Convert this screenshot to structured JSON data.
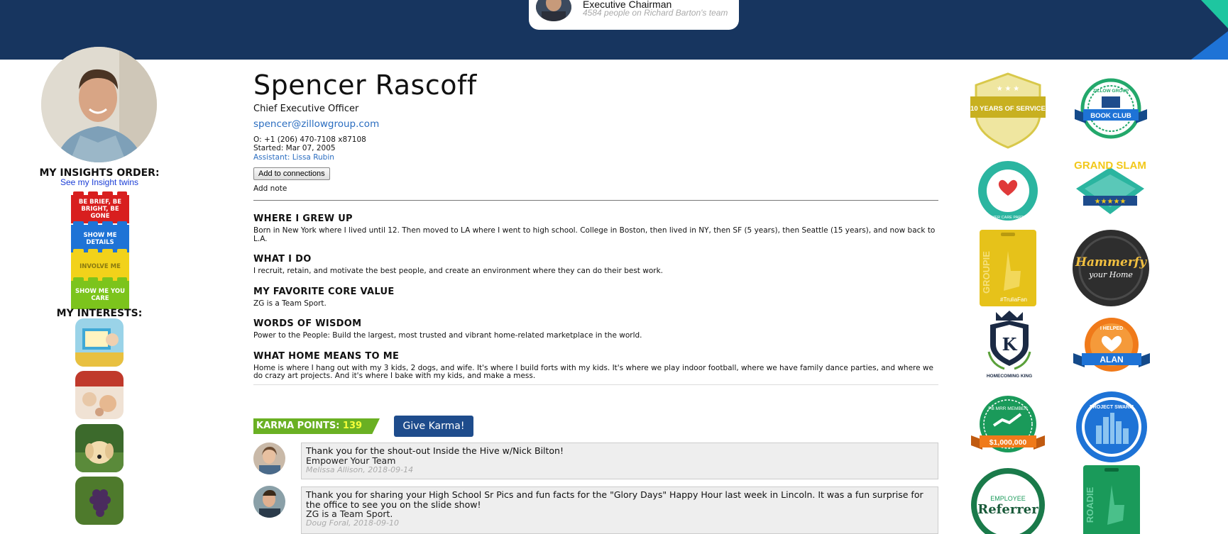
{
  "header": {
    "manager_title": "Executive Chairman",
    "manager_team": "4584 people on Richard Barton's team"
  },
  "left": {
    "insights_heading": "MY INSIGHTS ORDER:",
    "twins_link": "See my Insight twins",
    "insights": [
      {
        "label": "BE BRIEF, BE BRIGHT, BE GONE",
        "color": "#d81f1f"
      },
      {
        "label": "SHOW ME DETAILS",
        "color": "#1e73d6"
      },
      {
        "label": "INVOLVE ME",
        "color": "#f2d21a"
      },
      {
        "label": "SHOW ME YOU CARE",
        "color": "#7cc41c"
      }
    ],
    "interests_heading": "MY INTERESTS:"
  },
  "profile": {
    "name": "Spencer Rascoff",
    "title": "Chief Executive Officer",
    "email": "spencer@zillowgroup.com",
    "phone": "O: +1 (206) 470-7108 x87108",
    "started": "Started: Mar 07, 2005",
    "assistant": "Assistant: Lissa Rubin",
    "add_connections": "Add to connections",
    "add_note": "Add note"
  },
  "sections": [
    {
      "heading": "WHERE I GREW UP",
      "text": "Born in New York where I lived until 12. Then moved to LA where I went to high school. College in Boston, then lived in NY, then SF (5 years), then Seattle (15 years), and now back to L.A."
    },
    {
      "heading": "WHAT I DO",
      "text": "I recruit, retain, and motivate the best people, and create an environment where they can do their best work."
    },
    {
      "heading": "MY FAVORITE CORE VALUE",
      "text": "ZG is a Team Sport."
    },
    {
      "heading": "WORDS OF WISDOM",
      "text": "Power to the People: Build the largest, most trusted and vibrant home-related marketplace in the world."
    },
    {
      "heading": "WHAT HOME MEANS TO ME",
      "text": "Home is where I hang out with my 3 kids, 2 dogs, and wife. It's where I build forts with my kids. It's where we play indoor football, where we have family dance parties, and where we do crazy art projects. And it's where I bake with my kids, and make a mess."
    }
  ],
  "karma": {
    "label": "KARMA POINTS: ",
    "points": "139",
    "give_button": "Give Karma!"
  },
  "feedback": [
    {
      "text": "Thank you for the shout-out Inside the Hive w/Nick Bilton!",
      "value": "Empower Your Team",
      "meta": "Melissa Allison, 2018-09-14"
    },
    {
      "text": "Thank you for sharing your High School Sr Pics and fun facts for the \"Glory Days\" Happy Hour last week in Lincoln. It was a fun surprise for the office to see you on the slide show!",
      "value": "ZG is a Team Sport.",
      "meta": "Doug Foral, 2018-09-10"
    }
  ],
  "badges": {
    "b1": "10 YEARS OF SERVICE",
    "b2_top": "ZILLOW GROUP",
    "b2": "BOOK CLUB",
    "b3": "CONSUMER CARE PARTICIPANT",
    "b4": "GRAND SLAM",
    "b5": "GROUPIE",
    "b5b": "#TruliaFan",
    "b6a": "Hammerfy",
    "b6b": "your Home",
    "b7": "K",
    "b7b": "HOMECOMING KING",
    "b8a": "I HELPED",
    "b8": "ALAN",
    "b9a": "PB MRR MEMBER",
    "b9": "$1,000,000",
    "b10": "PROJECT SWARM",
    "b11a": "EMPLOYEE",
    "b11": "Referrer",
    "b12": "ROADIE"
  }
}
